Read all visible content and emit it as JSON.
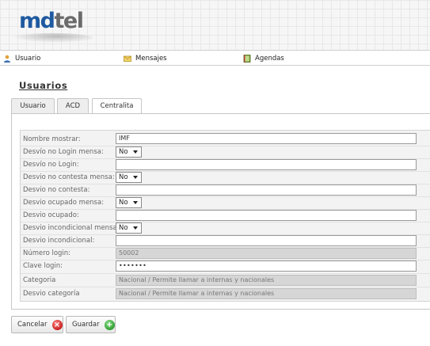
{
  "header": {
    "logo_md": "md",
    "logo_tel": "tel"
  },
  "nav": {
    "items": [
      {
        "label": "Usuario",
        "icon": "user-icon"
      },
      {
        "label": "Mensajes",
        "icon": "envelope-icon"
      },
      {
        "label": "Agendas",
        "icon": "book-icon"
      }
    ]
  },
  "page": {
    "title": "Usuarios",
    "tabs": [
      "Usuario",
      "ACD",
      "Centralita"
    ],
    "active_tab": "Centralita"
  },
  "form": {
    "nombre_mostrar": {
      "label": "Nombre mostrar:",
      "value": "IMF"
    },
    "desvio_no_login_mensa": {
      "label": "Desvío no Login mensa:",
      "value": "No"
    },
    "desvio_no_login": {
      "label": "Desvío no Login:",
      "value": ""
    },
    "desvio_no_contesta_mensa": {
      "label": "Desvio no contesta mensa:",
      "value": "No"
    },
    "desvio_no_contesta": {
      "label": "Desvio no contesta:",
      "value": ""
    },
    "desvio_ocupado_mensa": {
      "label": "Desvio ocupado mensa:",
      "value": "No"
    },
    "desvio_ocupado": {
      "label": "Desvio ocupado:",
      "value": ""
    },
    "desvio_incondicional_mensa": {
      "label": "Desvio incondicional mensa:",
      "value": "No"
    },
    "desvio_incondicional": {
      "label": "Desvio incondicional:",
      "value": ""
    },
    "numero_login": {
      "label": "Número login:",
      "value": "50002"
    },
    "clave_login": {
      "label": "Clave login:",
      "value": "•••••••"
    },
    "categoria": {
      "label": "Categoria",
      "value": "Nacional / Permite llamar a internas y nacionales"
    },
    "desvio_categoria": {
      "label": "Desvio categoría",
      "value": "Nacional / Permite llamar a internas y nacionales"
    }
  },
  "buttons": {
    "cancel": {
      "label": "Cancelar",
      "icon": "x-circle-icon",
      "color": "#c81e1e"
    },
    "save": {
      "label": "Guardar",
      "icon": "plus-circle-icon",
      "color": "#2f9e2f"
    }
  }
}
